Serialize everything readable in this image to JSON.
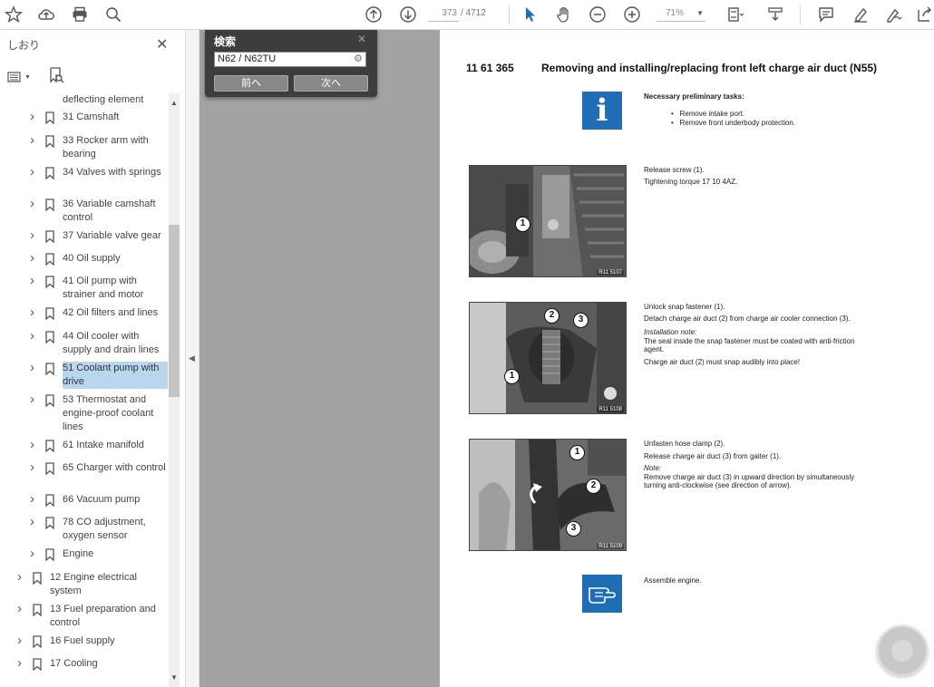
{
  "toolbar": {
    "page_current": "373",
    "page_total": "/ 4712",
    "zoom": "71%"
  },
  "sidebar": {
    "title": "しおり",
    "items": [
      {
        "label": "deflecting element",
        "level": 2,
        "expandable": false,
        "flag": false
      },
      {
        "label": "31 Camshaft",
        "level": 2,
        "expandable": true
      },
      {
        "label": "33 Rocker arm with bearing",
        "level": 2,
        "expandable": true
      },
      {
        "label": "34 Valves with springs",
        "level": 2,
        "expandable": true
      },
      {
        "label": "36 Variable camshaft control",
        "level": 2,
        "expandable": true
      },
      {
        "label": "37 Variable valve gear",
        "level": 2,
        "expandable": true
      },
      {
        "label": "40 Oil supply",
        "level": 2,
        "expandable": true
      },
      {
        "label": "41 Oil pump with strainer and motor",
        "level": 2,
        "expandable": true
      },
      {
        "label": "42 Oil filters and lines",
        "level": 2,
        "expandable": true
      },
      {
        "label": "44 Oil cooler with supply and drain lines",
        "level": 2,
        "expandable": true
      },
      {
        "label": "51 Coolant pump with drive",
        "level": 2,
        "expandable": true,
        "selected": true
      },
      {
        "label": "53 Thermostat and engine-proof coolant lines",
        "level": 2,
        "expandable": true
      },
      {
        "label": "61 Intake manifold",
        "level": 2,
        "expandable": true
      },
      {
        "label": "65 Charger with control",
        "level": 2,
        "expandable": true
      },
      {
        "label": "66 Vacuum pump",
        "level": 2,
        "expandable": true
      },
      {
        "label": "78 CO adjustment, oxygen sensor",
        "level": 2,
        "expandable": true
      },
      {
        "label": "Engine",
        "level": 2,
        "expandable": true
      },
      {
        "label": "12 Engine electrical system",
        "level": 1,
        "expandable": true
      },
      {
        "label": "13 Fuel preparation and control",
        "level": 1,
        "expandable": true
      },
      {
        "label": "16 Fuel supply",
        "level": 1,
        "expandable": true
      },
      {
        "label": "17 Cooling",
        "level": 1,
        "expandable": true
      }
    ]
  },
  "search": {
    "title": "検索",
    "query": "N62 / N62TU",
    "prev_label": "前へ",
    "next_label": "次へ"
  },
  "document": {
    "number": "11 61 365",
    "title": "Removing and installing/replacing front left charge air duct (N55)",
    "prelim_heading": "Necessary preliminary tasks:",
    "prelim_items": [
      "Remove intake port.",
      "Remove front underbody protection."
    ],
    "step1": {
      "line1": "Release screw (1).",
      "line2": "Tightening torque 17 10 4AZ.",
      "caption": "R11 5107"
    },
    "step2": {
      "line1": "Unlock snap fastener (1).",
      "line2": "Detach charge air duct (2) from charge air cooler connection (3).",
      "note_label": "Installation note:",
      "note_line1": "The seal inside the snap fastener must be coated with anti-friction",
      "note_line2": "agent.",
      "line3": "Charge air duct (2) must snap audibly into place!",
      "caption": "R11 5108"
    },
    "step3": {
      "line1": "Unfasten hose clamp (2).",
      "line2": "Release charge air duct (3) from gaiter (1).",
      "note_label": "Note:",
      "note_line1": "Remove charge air duct (3) in upward direction by simultaneously",
      "note_line2": "turning anti-clockwise (see direction of arrow).",
      "caption": "R11 5109"
    },
    "final": "Assemble engine.",
    "callouts": {
      "one": "1",
      "two": "2",
      "three": "3"
    },
    "info_glyph": "i"
  },
  "colors": {
    "accent": "#1f6eb5",
    "selection": "#b8d6f0",
    "viewer_bg": "#a3a3a3",
    "search_bg": "#3d3d3d"
  }
}
